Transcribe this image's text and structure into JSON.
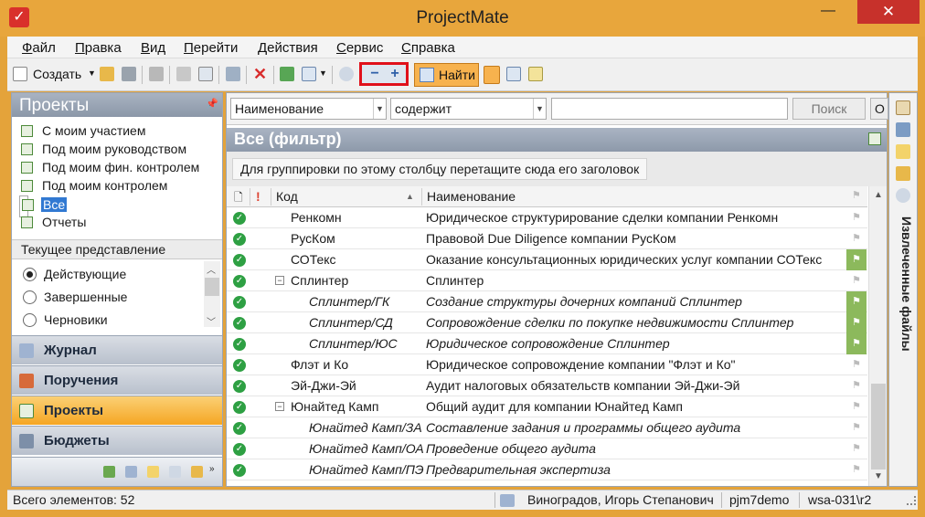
{
  "app": {
    "title": "ProjectMate",
    "min": "—",
    "max": "□",
    "close": "✕"
  },
  "menu": [
    "Файл",
    "Правка",
    "Вид",
    "Перейти",
    "Действия",
    "Сервис",
    "Справка"
  ],
  "toolbar": {
    "create": "Создать",
    "find": "Найти",
    "zoom_out": "−",
    "zoom_in": "+"
  },
  "projects_panel": {
    "title": "Проекты",
    "pin": "⌂",
    "items": [
      "С моим участием",
      "Под моим руководством",
      "Под моим фин. контролем",
      "Под моим контролем",
      "Все",
      "Отчеты"
    ],
    "selected": "Все"
  },
  "current_view": {
    "label": "Текущее представление",
    "options": [
      "Действующие",
      "Завершенные",
      "Черновики"
    ],
    "selected": "Действующие"
  },
  "nav": [
    {
      "label": "Журнал",
      "icon": "calendar-icon"
    },
    {
      "label": "Поручения",
      "icon": "task-icon"
    },
    {
      "label": "Проекты",
      "icon": "projects-icon",
      "active": true
    },
    {
      "label": "Бюджеты",
      "icon": "budget-icon"
    }
  ],
  "filter": {
    "field": "Наименование",
    "op": "содержит",
    "value": "",
    "search": "Поиск",
    "extra": "О"
  },
  "grid_header": {
    "title": "Все (фильтр)",
    "group_hint": "Для группировки по этому столбцу перетащите сюда его заголовок",
    "columns": [
      "Код",
      "Наименование"
    ]
  },
  "rows": [
    {
      "code": "Ренкомн",
      "name": "Юридическое структурирование сделки компании Ренкомн",
      "level": 0,
      "flag": false
    },
    {
      "code": "РусКом",
      "name": "Правовой Due Diligence компании РусКом",
      "level": 0,
      "flag": false
    },
    {
      "code": "СОТекс",
      "name": "Оказание консультационных юридических услуг компании СОТекс",
      "level": 0,
      "flag": true
    },
    {
      "code": "Сплинтер",
      "name": "Сплинтер",
      "level": 0,
      "flag": false,
      "group": true
    },
    {
      "code": "Сплинтер/ГК",
      "name": "Создание структуры дочерних компаний Сплинтер",
      "level": 1,
      "flag": true
    },
    {
      "code": "Сплинтер/СД",
      "name": "Сопровождение сделки по покупке недвижимости Сплинтер",
      "level": 1,
      "flag": true
    },
    {
      "code": "Сплинтер/ЮС",
      "name": "Юридическое сопровождение Сплинтер",
      "level": 1,
      "flag": true
    },
    {
      "code": "Флэт и Ко",
      "name": "Юридическое сопровождение компании \"Флэт и Ко\"",
      "level": 0,
      "flag": false
    },
    {
      "code": "Эй-Джи-Эй",
      "name": "Аудит налоговых обязательств компании Эй-Джи-Эй",
      "level": 0,
      "flag": false
    },
    {
      "code": "Юнайтед Камп",
      "name": "Общий аудит для компании Юнайтед Камп",
      "level": 0,
      "flag": false,
      "group": true
    },
    {
      "code": "Юнайтед Камп/ЗА",
      "name": "Составление задания и программы общего аудита",
      "level": 1,
      "flag": false
    },
    {
      "code": "Юнайтед Камп/ОА",
      "name": "Проведение общего аудита",
      "level": 1,
      "flag": false
    },
    {
      "code": "Юнайтед Камп/ПЭ",
      "name": "Предварительная экспертиза",
      "level": 1,
      "flag": false
    }
  ],
  "right_panel": {
    "label": "Извлеченные файлы"
  },
  "status": {
    "count": "Всего элементов: 52",
    "user": "Виноградов, Игорь Степанович",
    "db": "pjm7demo",
    "server": "wsa-031\\r2"
  }
}
